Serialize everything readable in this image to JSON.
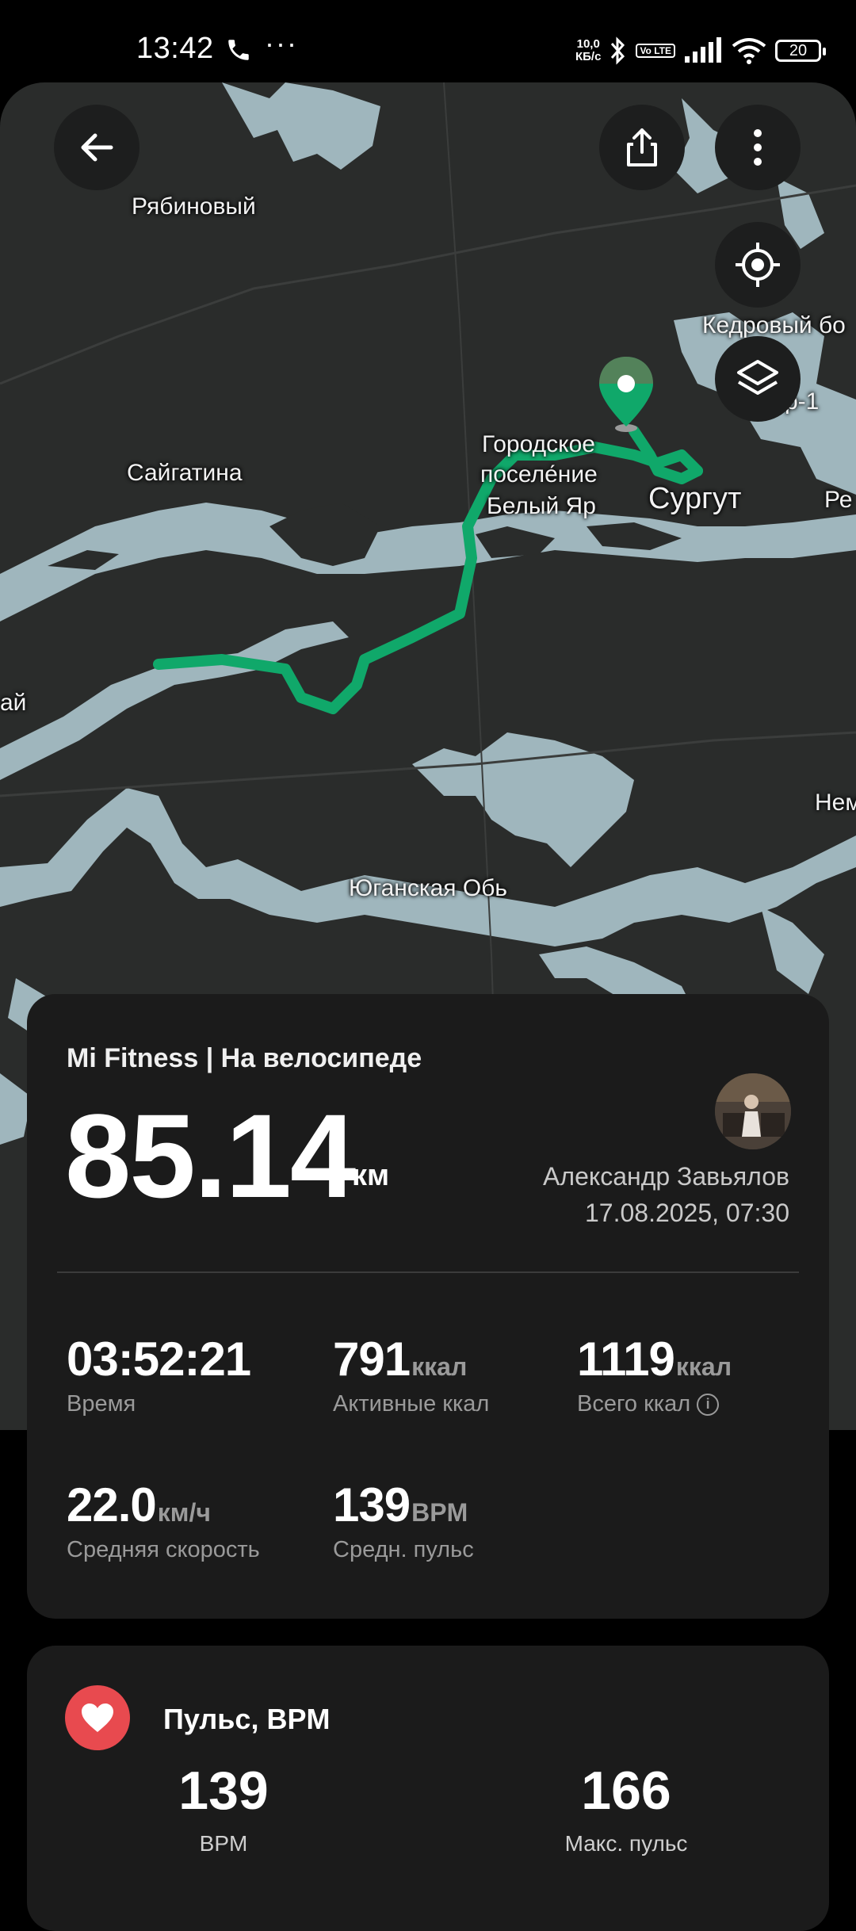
{
  "status_bar": {
    "time": "13:42",
    "net_speed_value": "10,0",
    "net_speed_unit": "КБ/с",
    "volte": "Vo LTE",
    "battery": "20"
  },
  "map": {
    "labels": {
      "ryabinovy": "Рябиновый",
      "kedrovy": "Кедровый бо",
      "r1": "р-1",
      "saygatina": "Сайгатина",
      "gorodskoe": "Городское",
      "poselenie": "поселе́ние",
      "bely_yar": "Белый Яр",
      "surgut": "Сургут",
      "re": "Ре",
      "ai": "ай",
      "nem": "Нем",
      "yuganskaya": "Юганская Обь"
    },
    "colors": {
      "route": "#10a86a",
      "water": "#9fb6bd",
      "land": "#2a2c2b"
    }
  },
  "workout": {
    "title": "Mi Fitness | На велосипеде",
    "distance": "85.14",
    "distance_unit": "км",
    "user_name": "Александр Завьялов",
    "date": "17.08.2025, 07:30",
    "metrics": {
      "time": {
        "value": "03:52:21",
        "label": "Время"
      },
      "active_kcal": {
        "value": "791",
        "unit": "ккал",
        "label": "Активные ккал"
      },
      "total_kcal": {
        "value": "1119",
        "unit": "ккал",
        "label": "Всего ккал"
      },
      "avg_speed": {
        "value": "22.0",
        "unit": "км/ч",
        "label": "Средняя скорость"
      },
      "avg_pulse": {
        "value": "139",
        "unit": "BPM",
        "label": "Средн. пульс"
      }
    }
  },
  "pulse_card": {
    "title": "Пульс, BPM",
    "avg_value": "139",
    "avg_label": "BPM",
    "max_value": "166",
    "max_label": "Макс. пульс",
    "accent": "#e84a4f"
  }
}
